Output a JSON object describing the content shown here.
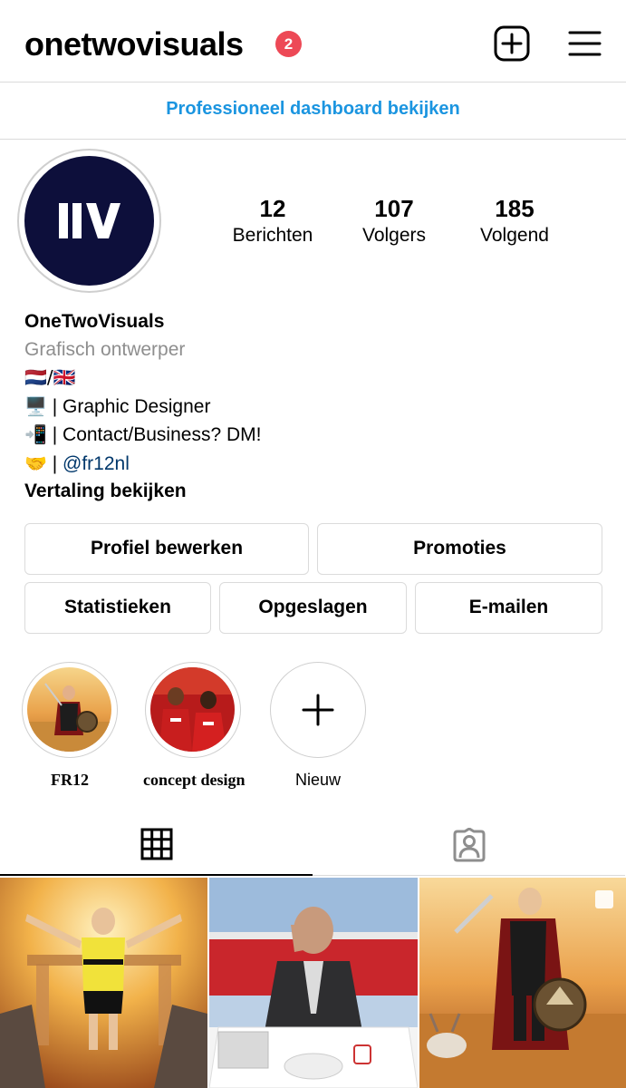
{
  "header": {
    "username": "onetwovisuals",
    "notification_count": "2",
    "new_post_icon": "plus-square-icon",
    "menu_icon": "hamburger-menu-icon"
  },
  "dashboard_link": "Professioneel dashboard bekijken",
  "profile": {
    "avatar_logo_text": "IIV",
    "stats": [
      {
        "value": "12",
        "label": "Berichten"
      },
      {
        "value": "107",
        "label": "Volgers"
      },
      {
        "value": "185",
        "label": "Volgend"
      }
    ]
  },
  "bio": {
    "name": "OneTwoVisuals",
    "category": "Grafisch ontwerper",
    "flags": "🇳🇱/🇬🇧",
    "line1_emoji": "🖥️",
    "line1_text": " | Graphic Designer",
    "line2_emoji": "📲",
    "line2_text": " | Contact/Business? DM!",
    "line3_emoji": "🤝",
    "line3_text": " | ",
    "mention": "@fr12nl",
    "translate": "Vertaling bekijken"
  },
  "buttons": {
    "edit_profile": "Profiel bewerken",
    "promotions": "Promoties",
    "insights": "Statistieken",
    "saved": "Opgeslagen",
    "email": "E-mailen"
  },
  "highlights": [
    {
      "label": "FR12"
    },
    {
      "label": "concept design"
    },
    {
      "label": "Nieuw"
    }
  ],
  "tabs": {
    "grid_icon": "grid-icon",
    "tagged_icon": "tagged-person-icon"
  },
  "colors": {
    "link_blue": "#1b95e0",
    "badge_red": "#ed4956",
    "border_gray": "#dbdbdb",
    "muted_gray": "#8e8e8e",
    "avatar_navy": "#0d0f3b",
    "mention_blue": "#00376b"
  }
}
